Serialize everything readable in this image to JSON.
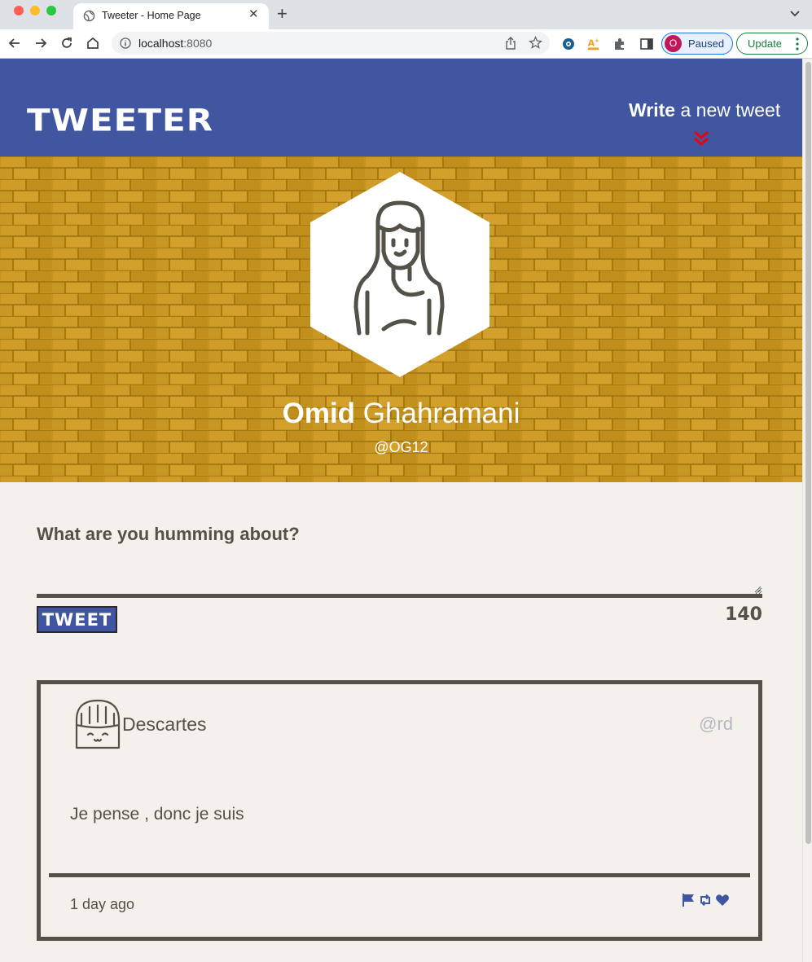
{
  "browser": {
    "tab_title": "Tweeter - Home Page",
    "url_host": "localhost",
    "url_port": ":8080",
    "profile_initial": "O",
    "profile_status": "Paused",
    "update_label": "Update"
  },
  "navbar": {
    "brand": "TWEETER",
    "compose_bold": "Write",
    "compose_rest": " a new tweet"
  },
  "profile": {
    "first_name": "Omid",
    "last_name": " Ghahramani",
    "handle": "@OG12"
  },
  "compose": {
    "prompt": "What are you humming about?",
    "textarea_value": "",
    "button_label": "TWEET",
    "counter": "140"
  },
  "tweets": [
    {
      "author": "Descartes",
      "handle": "@rd",
      "content": "Je pense , donc je suis",
      "time": "1 day ago",
      "actions": [
        "flag-icon",
        "retweet-icon",
        "heart-icon"
      ]
    }
  ],
  "colors": {
    "navbar": "#4056a1",
    "hero": "#c7951f",
    "text": "#545149",
    "page_bg": "#f4f1ec",
    "chevron": "#e30613"
  }
}
